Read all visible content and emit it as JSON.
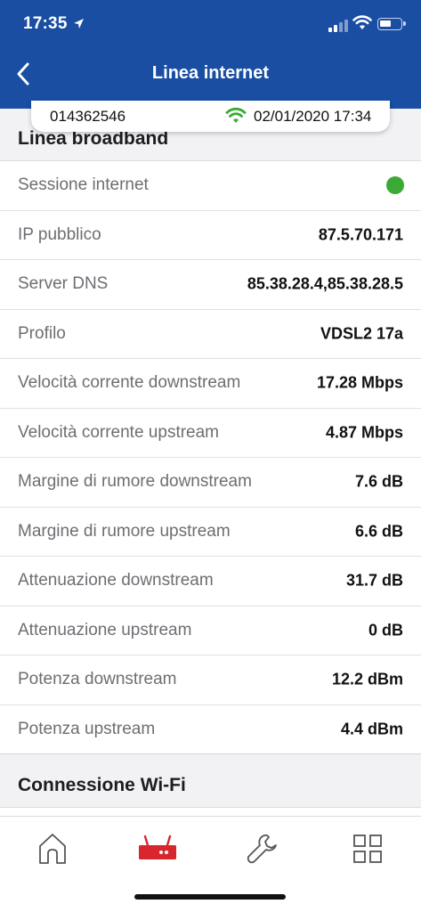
{
  "status_bar": {
    "time": "17:35"
  },
  "nav": {
    "title": "Linea internet"
  },
  "info_card": {
    "line_id": "014362546",
    "timestamp": "02/01/2020 17:34"
  },
  "sections": {
    "broadband": {
      "title": "Linea broadband"
    },
    "wifi": {
      "title": "Connessione Wi-Fi"
    }
  },
  "rows": [
    {
      "label": "Sessione internet",
      "value": "",
      "status_color": "#3aaa35"
    },
    {
      "label": "IP pubblico",
      "value": "87.5.70.171"
    },
    {
      "label": "Server DNS",
      "value": "85.38.28.4,85.38.28.5"
    },
    {
      "label": "Profilo",
      "value": "VDSL2 17a"
    },
    {
      "label": "Velocità corrente downstream",
      "value": "17.28 Mbps"
    },
    {
      "label": "Velocità corrente upstream",
      "value": "4.87 Mbps"
    },
    {
      "label": "Margine di rumore downstream",
      "value": "7.6 dB"
    },
    {
      "label": "Margine di rumore upstream",
      "value": "6.6 dB"
    },
    {
      "label": "Attenuazione downstream",
      "value": "31.7 dB"
    },
    {
      "label": "Attenuazione upstream",
      "value": "0 dB"
    },
    {
      "label": "Potenza downstream",
      "value": "12.2 dBm"
    },
    {
      "label": "Potenza upstream",
      "value": "4.4 dBm"
    }
  ],
  "tabs": [
    {
      "icon": "home-icon",
      "active": false
    },
    {
      "icon": "router-icon",
      "active": true
    },
    {
      "icon": "wrench-icon",
      "active": false
    },
    {
      "icon": "grid-icon",
      "active": false
    }
  ],
  "colors": {
    "header": "#1a4ea3",
    "accent": "#d9262e",
    "status_ok": "#3aaa35"
  }
}
